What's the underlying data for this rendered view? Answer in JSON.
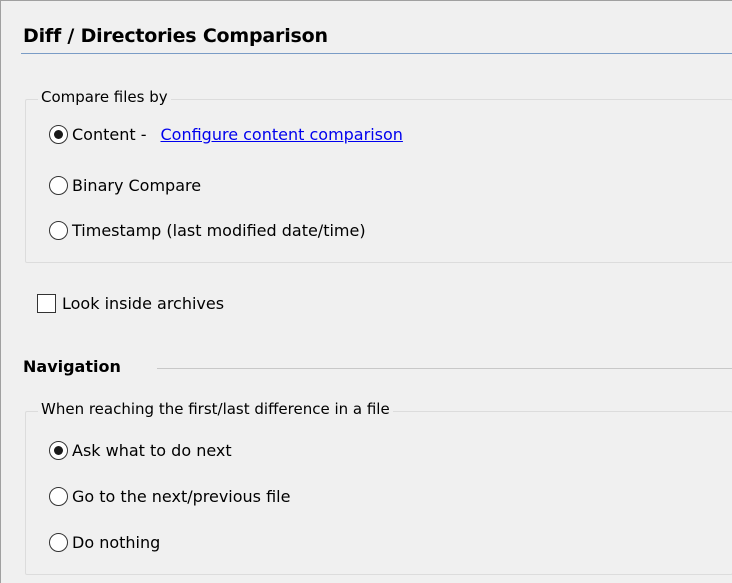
{
  "page": {
    "title": "Diff / Directories Comparison"
  },
  "compare_group": {
    "legend": "Compare files by",
    "options": [
      {
        "label": "Content -",
        "checked": true
      },
      {
        "label": "Binary Compare",
        "checked": false
      },
      {
        "label": "Timestamp (last modified date/time)",
        "checked": false
      }
    ],
    "configure_link": "Configure content comparison"
  },
  "archives": {
    "label": "Look inside archives",
    "checked": false
  },
  "navigation": {
    "title": "Navigation",
    "group_legend": "When reaching the first/last difference in a file",
    "options": [
      {
        "label": "Ask what to do next",
        "checked": true
      },
      {
        "label": "Go to the next/previous file",
        "checked": false
      },
      {
        "label": "Do nothing",
        "checked": false
      }
    ]
  },
  "colors": {
    "link": "#0000ee",
    "title_rule": "#7a9cc6",
    "panel_bg": "#f0f0f0"
  }
}
